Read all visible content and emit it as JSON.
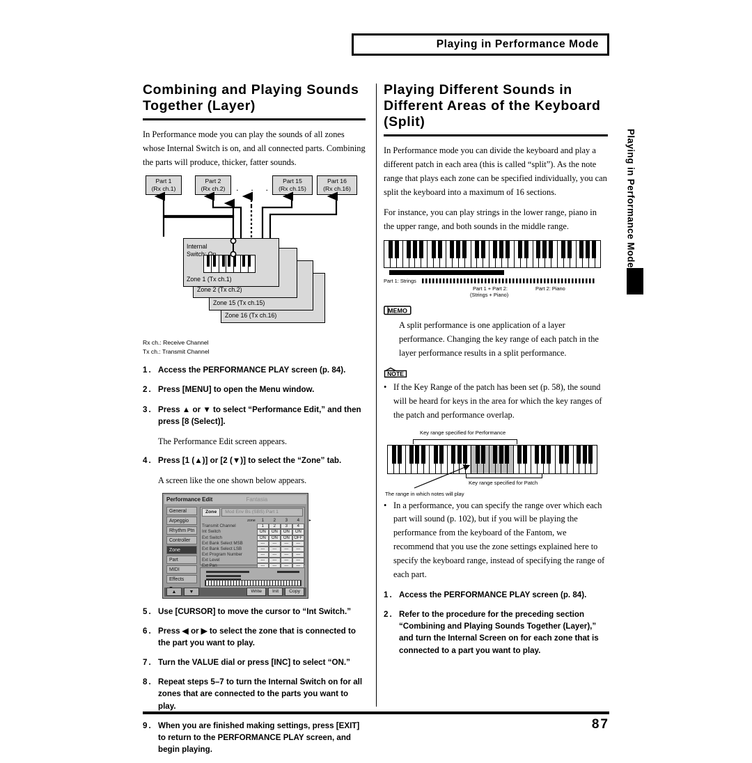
{
  "header": {
    "title": "Playing in Performance Mode"
  },
  "side_tab": {
    "label": "Playing in Performance Mode"
  },
  "footer": {
    "page_number": "87"
  },
  "left": {
    "heading": "Combining and Playing Sounds Together (Layer)",
    "intro": "In Performance mode you can play the sounds of all zones whose Internal Switch is on, and all connected parts. Combining the parts will produce, thicker, fatter sounds.",
    "diagram": {
      "parts": [
        {
          "name": "Part 1",
          "ch": "(Rx ch.1)"
        },
        {
          "name": "Part 2",
          "ch": "(Rx ch.2)"
        },
        {
          "name": "Part 15",
          "ch": "(Rx ch.15)"
        },
        {
          "name": "Part 16",
          "ch": "(Rx ch.16)"
        }
      ],
      "dots": ". . . . .",
      "internal_switch": "Internal\nSwitch: On",
      "internal_switch_line1": "Internal",
      "internal_switch_line2": "Switch: On",
      "zones": [
        "Zone 1 (Tx ch.1)",
        "Zone 2 (Tx ch.2)",
        "Zone 15 (Tx ch.15)",
        "Zone 16 (Tx ch.16)"
      ],
      "legend_rx": "Rx ch.: Receive Channel",
      "legend_tx": "Tx ch.: Transmit Channel"
    },
    "steps_a": [
      {
        "num": "1.",
        "text": "Access the PERFORMANCE PLAY screen (p. 84)."
      },
      {
        "num": "2.",
        "text": "Press [MENU] to open the Menu window."
      },
      {
        "num": "3.",
        "text": "Press ▲ or ▼ to select “Performance Edit,” and then press [8 (Select)].",
        "sub": "The Performance Edit screen appears."
      },
      {
        "num": "4.",
        "text": "Press [1 (▲)] or [2 (▼)] to select the “Zone” tab.",
        "sub": "A screen like the one shown below appears."
      }
    ],
    "lcd": {
      "title": "Performance Edit",
      "title_right": "Fantasia",
      "menu": [
        "General",
        "Arpeggio",
        "Rhythm Ptn",
        "Controller",
        "Zone",
        "Part",
        "MIDI",
        "Effects",
        "▼"
      ],
      "menu_selected": "Zone",
      "tabs": [
        "Zone",
        "Mod  Env  Bs     (SBS) Part 1"
      ],
      "tab_selected": "Zone",
      "zone_header_label": "zone",
      "zone_columns": [
        "1",
        "2",
        "3",
        "4",
        "▸"
      ],
      "rows": [
        {
          "label": "Transmit Channel",
          "values": [
            "1",
            "2",
            "3",
            "4"
          ]
        },
        {
          "label": "Int Switch",
          "values": [
            "ON",
            "ON",
            "ON",
            "ON"
          ]
        },
        {
          "label": "Ext Switch",
          "values": [
            "ON",
            "ON",
            "ON",
            "OFF"
          ]
        },
        {
          "label": "Ext Bank Select MSB",
          "values": [
            "---",
            "---",
            "---",
            "---"
          ]
        },
        {
          "label": "Ext Bank Select LSB",
          "values": [
            "---",
            "---",
            "---",
            "---"
          ]
        },
        {
          "label": "Ext Program Number",
          "values": [
            "---",
            "---",
            "---",
            "---"
          ]
        },
        {
          "label": "Ext Level",
          "values": [
            "---",
            "---",
            "---",
            "---"
          ]
        },
        {
          "label": "Ext Pan",
          "values": [
            "---",
            "---",
            "---",
            "---"
          ]
        }
      ],
      "footer_buttons": [
        "Write",
        "Init",
        "Copy"
      ],
      "arrow_buttons": [
        "▲",
        "▼"
      ]
    },
    "steps_b": [
      {
        "num": "5.",
        "text": "Use [CURSOR] to move the cursor to “Int Switch.”"
      },
      {
        "num": "6.",
        "text": "Press ◀ or ▶ to select the zone that is connected to the part you want to play."
      },
      {
        "num": "7.",
        "text": "Turn the VALUE dial or press [INC] to select “ON.”"
      },
      {
        "num": "8.",
        "text": "Repeat steps 5–7 to turn the Internal Switch on for all zones that are connected to the parts you want to play."
      },
      {
        "num": "9.",
        "text": "When you are finished making settings, press [EXIT] to return to the PERFORMANCE PLAY screen, and begin playing."
      }
    ]
  },
  "right": {
    "heading": "Playing Different Sounds in Different Areas of the Keyboard (Split)",
    "intro1": "In Performance mode you can divide the keyboard and play a different patch in each area (this is called “split”). As the note range that plays each zone can be specified individually, you can split the keyboard into a maximum of 16 sections.",
    "intro2": "For instance, you can play strings in the lower range, piano in the upper range, and both sounds in the middle range.",
    "split_diagram": {
      "label_part1": "Part 1: Strings",
      "label_both_line1": "Part 1 + Part 2:",
      "label_both_line2": "(Strings + Piano)",
      "label_part2": "Part 2: Piano"
    },
    "memo": {
      "badge": "MEMO",
      "text": "A split performance is one application of a layer performance. Changing the key range of each patch in the layer performance results in a split performance."
    },
    "note": {
      "badge": "NOTE",
      "bullets": [
        "If the Key Range of the patch has been set (p. 58), the sound will be heard for keys in the area for which the key ranges of the patch and performance overlap."
      ]
    },
    "range_diagram": {
      "label_performance": "Key range specified for Performance",
      "label_patch": "Key range specified for Patch",
      "label_play": "The range in which notes will play"
    },
    "bullets2": [
      "In a performance, you can specify the range over which each part will sound (p. 102), but if you will be playing the performance from the keyboard of the Fantom, we recommend that you use the zone settings explained here to specify the keyboard range, instead of specifying the range of each part."
    ],
    "steps": [
      {
        "num": "1.",
        "text": "Access the PERFORMANCE PLAY screen (p. 84)."
      },
      {
        "num": "2.",
        "text": "Refer to the procedure for the preceding section “Combining and Playing Sounds Together (Layer),” and turn the Internal Screen on for each zone that is connected to a part you want to play."
      }
    ]
  },
  "colors": {
    "ink": "#000000",
    "panel_grey": "#d9d9d9",
    "lcd_grey": "#9a9a9a"
  }
}
